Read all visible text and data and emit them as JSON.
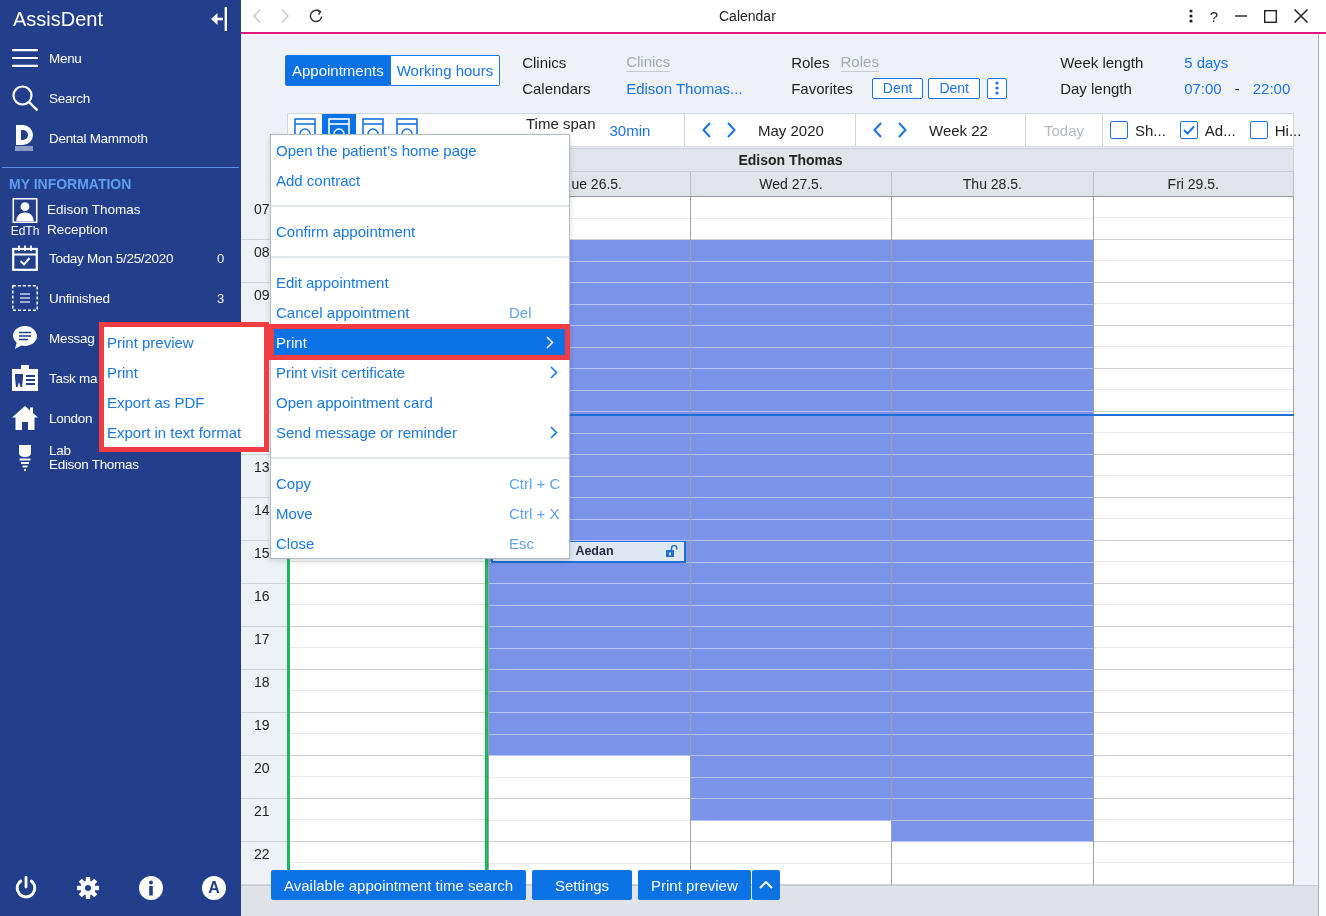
{
  "window": {
    "title": "Calendar",
    "help": "?",
    "back": {
      "disabled": true
    },
    "forward": {
      "disabled": true
    }
  },
  "sidebar": {
    "app_name": "AssisDent",
    "nav": [
      {
        "kind": "menu",
        "label": "Menu"
      },
      {
        "kind": "search",
        "label": "Search"
      },
      {
        "kind": "logo",
        "label": "Dental Mammoth"
      }
    ],
    "section_title": "MY INFORMATION",
    "user": {
      "initials": "EdTh",
      "name": "Edison Thomas",
      "role": "Reception"
    },
    "items": [
      {
        "kind": "today",
        "label": "Today Mon 5/25/2020",
        "count": "0"
      },
      {
        "kind": "unfinished",
        "label": "Unfinished",
        "count": "3"
      },
      {
        "kind": "messages",
        "label": "Messag"
      },
      {
        "kind": "tasks",
        "label": "Task ma"
      },
      {
        "kind": "clinic",
        "label": "London"
      },
      {
        "kind": "lab",
        "label": "Lab",
        "sublabel": "Edison Thomas"
      }
    ],
    "footer": [
      {
        "kind": "power"
      },
      {
        "kind": "settings"
      },
      {
        "kind": "info"
      },
      {
        "kind": "account",
        "label": "A"
      }
    ]
  },
  "filters": {
    "mode_tabs": [
      {
        "label": "Appointments",
        "selected": true
      },
      {
        "label": "Working hours",
        "selected": false
      }
    ],
    "clinics": {
      "label": "Clinics",
      "placeholder": "Clinics"
    },
    "calendars": {
      "label": "Calendars",
      "value": "Edison Thomas..."
    },
    "roles": {
      "label": "Roles",
      "placeholder": "Roles"
    },
    "favorites": {
      "label": "Favorites",
      "items": [
        "Dent",
        "Dent"
      ]
    },
    "week_length": {
      "label": "Week length",
      "value": "5 days"
    },
    "day_length": {
      "label": "Day length",
      "from": "07:00",
      "separator": "-",
      "to": "22:00"
    }
  },
  "toolbar": {
    "views": [
      {
        "selected": false
      },
      {
        "selected": true
      },
      {
        "selected": false
      },
      {
        "selected": false
      }
    ],
    "time_span": {
      "label": "Time span",
      "value": "30min"
    },
    "month": "May 2020",
    "week": "Week 22",
    "today": {
      "label": "Today",
      "disabled": true
    },
    "options": [
      {
        "label": "Sh...",
        "checked": false
      },
      {
        "label": "Ad...",
        "checked": true
      },
      {
        "label": "Hi...",
        "checked": false
      }
    ]
  },
  "calendar": {
    "owner": "Edison Thomas",
    "hours": [
      "07",
      "08",
      "09",
      "13",
      "14",
      "15",
      "16",
      "17",
      "18",
      "19",
      "20",
      "21",
      "22"
    ],
    "days": [
      {
        "today": true,
        "covered": false
      },
      {
        "label": "ue 26.5.",
        "today": false,
        "covered": true,
        "slots": [
          {
            "busy": false
          },
          {
            "busy": false
          },
          {
            "busy": true
          },
          {
            "busy": true
          },
          {
            "busy": true
          },
          {
            "busy": true
          },
          {
            "busy": true
          },
          {
            "busy": true
          },
          {
            "busy": true
          },
          {
            "busy": true
          },
          {
            "busy": true
          },
          {
            "busy": true
          },
          {
            "busy": true
          },
          {
            "busy": true
          },
          {
            "busy": true
          },
          {
            "busy": true
          },
          {
            "busy": true,
            "appointment": {
              "label": "Aedan",
              "covered": true
            }
          },
          {
            "busy": true
          },
          {
            "busy": true
          },
          {
            "busy": true
          },
          {
            "busy": true
          },
          {
            "busy": true
          },
          {
            "busy": true
          },
          {
            "busy": true
          },
          {
            "busy": true
          },
          {
            "busy": true
          },
          {
            "busy": false
          },
          {
            "busy": false
          },
          {
            "busy": false
          },
          {
            "busy": false
          },
          {
            "busy": false
          },
          {
            "busy": false
          }
        ]
      },
      {
        "label": "Wed 27.5.",
        "today": false,
        "covered": false,
        "slots": [
          {
            "busy": false
          },
          {
            "busy": false
          },
          {
            "busy": true
          },
          {
            "busy": true
          },
          {
            "busy": true
          },
          {
            "busy": true
          },
          {
            "busy": true
          },
          {
            "busy": true
          },
          {
            "busy": true
          },
          {
            "busy": true
          },
          {
            "busy": true
          },
          {
            "busy": true
          },
          {
            "busy": true
          },
          {
            "busy": true
          },
          {
            "busy": true
          },
          {
            "busy": true
          },
          {
            "busy": true
          },
          {
            "busy": true
          },
          {
            "busy": true
          },
          {
            "busy": true
          },
          {
            "busy": true
          },
          {
            "busy": true
          },
          {
            "busy": true
          },
          {
            "busy": true
          },
          {
            "busy": true
          },
          {
            "busy": true
          },
          {
            "busy": true
          },
          {
            "busy": true
          },
          {
            "busy": true
          },
          {
            "busy": false
          },
          {
            "busy": false
          },
          {
            "busy": false
          }
        ]
      },
      {
        "label": "Thu 28.5.",
        "today": false,
        "covered": false,
        "slots": [
          {
            "busy": false
          },
          {
            "busy": false
          },
          {
            "busy": true
          },
          {
            "busy": true
          },
          {
            "busy": true
          },
          {
            "busy": true
          },
          {
            "busy": true
          },
          {
            "busy": true
          },
          {
            "busy": true
          },
          {
            "busy": true
          },
          {
            "busy": true
          },
          {
            "busy": true
          },
          {
            "busy": true
          },
          {
            "busy": true
          },
          {
            "busy": true
          },
          {
            "busy": true
          },
          {
            "busy": true
          },
          {
            "busy": true
          },
          {
            "busy": true
          },
          {
            "busy": true
          },
          {
            "busy": true
          },
          {
            "busy": true
          },
          {
            "busy": true
          },
          {
            "busy": true
          },
          {
            "busy": true
          },
          {
            "busy": true
          },
          {
            "busy": true
          },
          {
            "busy": true
          },
          {
            "busy": true
          },
          {
            "busy": true
          },
          {
            "busy": false
          },
          {
            "busy": false
          }
        ]
      },
      {
        "label": "Fri 29.5.",
        "today": false,
        "covered": false
      }
    ]
  },
  "actions": [
    {
      "label": "Available appointment time search",
      "split": false
    },
    {
      "label": "Settings",
      "split": false
    },
    {
      "label": "Print preview",
      "split": true
    }
  ],
  "context_menu": {
    "items": [
      {
        "kind": "item",
        "label": "Open the patient’s home page",
        "selected": false,
        "submenu": false,
        "highlighted": false
      },
      {
        "kind": "item",
        "label": "Add contract",
        "selected": false,
        "submenu": false,
        "highlighted": false
      },
      {
        "kind": "separator"
      },
      {
        "kind": "item",
        "label": "Confirm appointment",
        "selected": false,
        "submenu": false,
        "highlighted": false
      },
      {
        "kind": "separator"
      },
      {
        "kind": "item",
        "label": "Edit appointment",
        "selected": false,
        "submenu": false,
        "highlighted": false
      },
      {
        "kind": "item",
        "label": "Cancel appointment",
        "shortcut": "Del",
        "selected": false,
        "submenu": false,
        "highlighted": false
      },
      {
        "kind": "item",
        "label": "Print",
        "selected": true,
        "submenu": true,
        "highlighted": true
      },
      {
        "kind": "item",
        "label": "Print visit certificate",
        "selected": false,
        "submenu": true,
        "highlighted": false
      },
      {
        "kind": "item",
        "label": "Open appointment card",
        "selected": false,
        "submenu": false,
        "highlighted": false
      },
      {
        "kind": "item",
        "label": "Send message or reminder",
        "selected": false,
        "submenu": true,
        "highlighted": false
      },
      {
        "kind": "separator"
      },
      {
        "kind": "item",
        "label": "Copy",
        "shortcut": "Ctrl + C",
        "selected": false,
        "submenu": false,
        "highlighted": false
      },
      {
        "kind": "item",
        "label": "Move",
        "shortcut": "Ctrl + X",
        "selected": false,
        "submenu": false,
        "highlighted": false
      },
      {
        "kind": "item",
        "label": "Close",
        "shortcut": "Esc",
        "selected": false,
        "submenu": false,
        "highlighted": false
      }
    ]
  },
  "submenu": {
    "highlighted": true,
    "items": [
      {
        "label": "Print preview"
      },
      {
        "label": "Print"
      },
      {
        "label": "Export as PDF"
      },
      {
        "label": "Export in text format"
      }
    ]
  }
}
